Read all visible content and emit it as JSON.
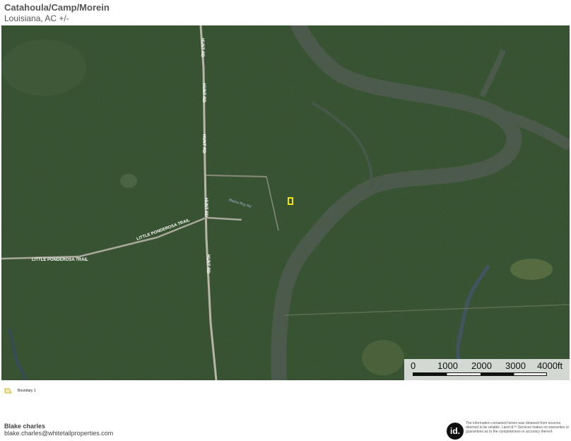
{
  "header": {
    "title": "Catahoula/Camp/Morein",
    "subtitle": "Louisiana,  AC +/-"
  },
  "map": {
    "roads": {
      "hunt_rd_1": "HUNT RD",
      "hunt_rd_2": "HUNT RD",
      "hunt_rd_3": "HUNT RD",
      "hunt_rd_4": "HUNT RD",
      "hunt_rd_5": "HUNT RD",
      "ponderosa_1": "LITTLE PONDEROSA TRAIL",
      "ponderosa_2": "LITTLE PONDEROSA TRAIL",
      "small_road": "Bayou Roy Rd"
    },
    "boundary_color": "#f2e600",
    "river_color": "#4b5a4a",
    "forest_color": "#2e4a2a"
  },
  "scale": {
    "labels": [
      "0",
      "1000",
      "2000",
      "3000",
      "4000ft"
    ]
  },
  "legend": {
    "label": "Boundary 1",
    "color": "#f2e600"
  },
  "agent": {
    "name": "Blake charles",
    "email": "blake.charles@whitetailproperties.com"
  },
  "logo": {
    "text": "id."
  },
  "disclaimer": "The information contained herein was obtained from sources deemed to be reliable. Land id™ Services makes no warranties or guarantees as to the completeness or accuracy thereof."
}
